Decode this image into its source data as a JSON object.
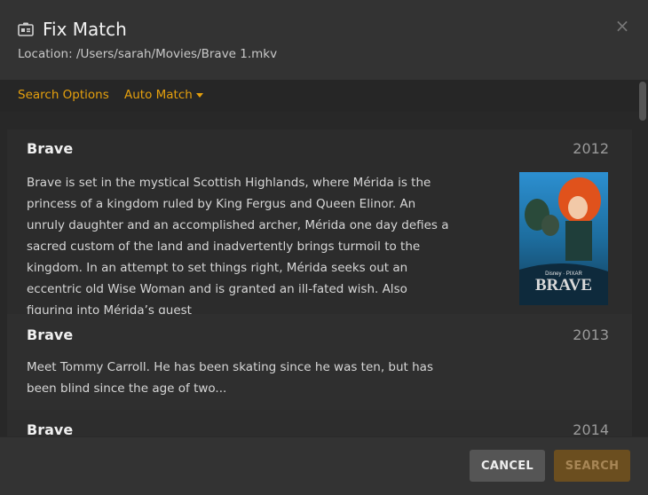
{
  "dialog": {
    "title": "Fix Match",
    "location": "Location: /Users/sarah/Movies/Brave 1.mkv",
    "close_symbol": "×"
  },
  "options": {
    "search_options": "Search Options",
    "auto_match": "Auto Match"
  },
  "results": [
    {
      "title": "Brave",
      "year": "2012",
      "summary": "Brave is set in the mystical Scottish Highlands, where Mérida is the princess of a kingdom ruled by King Fergus and Queen Elinor. An unruly daughter and an accomplished archer, Mérida one day defies a sacred custom of the land and inadvertently brings turmoil to the kingdom. In an attempt to set things right, Mérida seeks out an eccentric old Wise Woman and is granted an ill-fated wish. Also figuring into Mérida’s quest",
      "poster_text": "BRAVE",
      "poster_brand": "Disney · PIXAR"
    },
    {
      "title": "Brave",
      "year": "2013",
      "summary": "Meet Tommy Carroll. He has been skating since he was ten, but has been blind since the age of two..."
    },
    {
      "title": "Brave",
      "year": "2014"
    }
  ],
  "footer": {
    "cancel_label": "CANCEL",
    "search_label": "SEARCH"
  },
  "colors": {
    "accent": "#e5a00d",
    "background": "#333333",
    "list_background": "#282828"
  }
}
